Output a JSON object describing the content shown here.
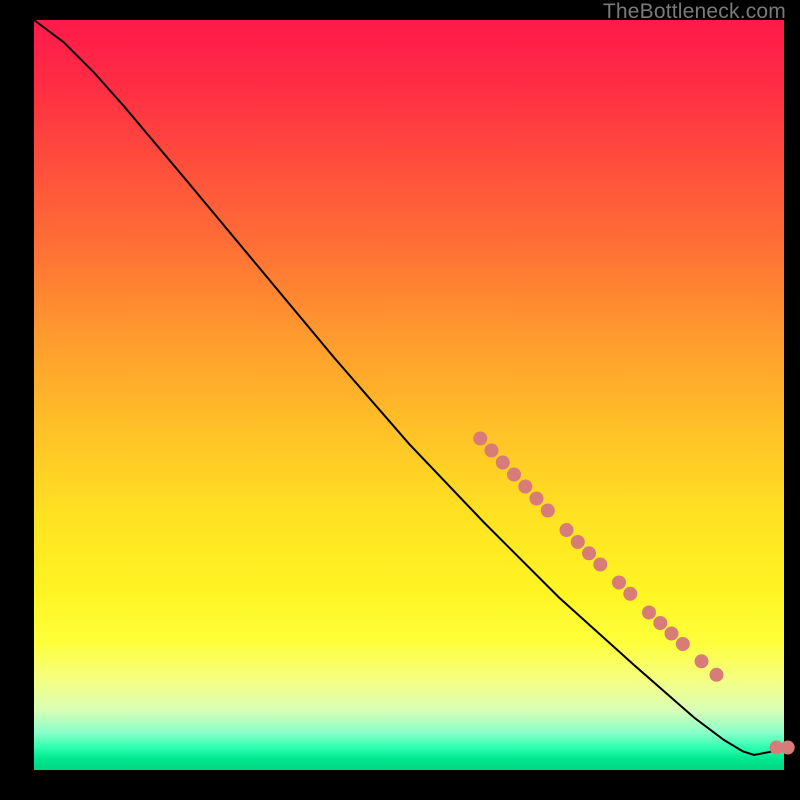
{
  "watermark": "TheBottleneck.com",
  "colors": {
    "marker": "#d77c78",
    "line": "#000000",
    "background_top": "#ff1a4b",
    "background_bottom": "#00d77f"
  },
  "chart_data": {
    "type": "line",
    "title": "",
    "xlabel": "",
    "ylabel": "",
    "xlim": [
      0,
      100
    ],
    "ylim": [
      0,
      100
    ],
    "grid": false,
    "legend": false,
    "curve": [
      {
        "x": 0,
        "y": 100
      },
      {
        "x": 4,
        "y": 97
      },
      {
        "x": 8,
        "y": 93
      },
      {
        "x": 12,
        "y": 88.5
      },
      {
        "x": 20,
        "y": 79
      },
      {
        "x": 30,
        "y": 67
      },
      {
        "x": 40,
        "y": 55
      },
      {
        "x": 50,
        "y": 43.5
      },
      {
        "x": 60,
        "y": 33
      },
      {
        "x": 70,
        "y": 23
      },
      {
        "x": 80,
        "y": 14
      },
      {
        "x": 88,
        "y": 7
      },
      {
        "x": 92,
        "y": 4
      },
      {
        "x": 94.5,
        "y": 2.5
      },
      {
        "x": 96,
        "y": 2
      },
      {
        "x": 98.5,
        "y": 2.5
      },
      {
        "x": 100,
        "y": 3
      }
    ],
    "markers": [
      {
        "x": 59.5,
        "y": 44.2,
        "r": 7
      },
      {
        "x": 61.0,
        "y": 42.6,
        "r": 7
      },
      {
        "x": 62.5,
        "y": 41.0,
        "r": 7
      },
      {
        "x": 64.0,
        "y": 39.4,
        "r": 7
      },
      {
        "x": 65.5,
        "y": 37.8,
        "r": 7
      },
      {
        "x": 67.0,
        "y": 36.2,
        "r": 7
      },
      {
        "x": 68.5,
        "y": 34.6,
        "r": 7
      },
      {
        "x": 71.0,
        "y": 32.0,
        "r": 7
      },
      {
        "x": 72.5,
        "y": 30.4,
        "r": 7
      },
      {
        "x": 74.0,
        "y": 28.9,
        "r": 7
      },
      {
        "x": 75.5,
        "y": 27.4,
        "r": 7
      },
      {
        "x": 78.0,
        "y": 25.0,
        "r": 7
      },
      {
        "x": 79.5,
        "y": 23.5,
        "r": 7
      },
      {
        "x": 82.0,
        "y": 21.0,
        "r": 7
      },
      {
        "x": 83.5,
        "y": 19.6,
        "r": 7
      },
      {
        "x": 85.0,
        "y": 18.2,
        "r": 7
      },
      {
        "x": 86.5,
        "y": 16.8,
        "r": 7
      },
      {
        "x": 89.0,
        "y": 14.5,
        "r": 7
      },
      {
        "x": 91.0,
        "y": 12.7,
        "r": 7
      },
      {
        "x": 99.0,
        "y": 3.0,
        "r": 7
      },
      {
        "x": 100.5,
        "y": 3.0,
        "r": 7
      }
    ]
  }
}
